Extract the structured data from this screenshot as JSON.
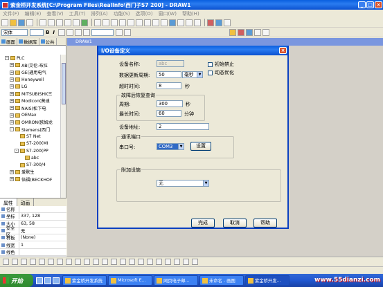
{
  "window": {
    "title": "紫金桥开发系统[C:\\Program Files\\RealInfo\\西门子S7 200] - DRAW1"
  },
  "menu": [
    "文件(F)",
    "编辑(E)",
    "查看(V)",
    "工具(T)",
    "排列(A)",
    "功能(S)",
    "选项(O)",
    "窗口(W)",
    "帮助(H)"
  ],
  "toolbar": {
    "font": "宋体",
    "bold": "B",
    "italic": "I"
  },
  "left_panel": {
    "tabs": [
      "画面",
      "数据库",
      "公共"
    ],
    "tree": [
      {
        "indent": 1,
        "sign": "-",
        "label": "PLC"
      },
      {
        "indent": 2,
        "sign": "+",
        "label": "AB(艾伦-布拉"
      },
      {
        "indent": 2,
        "sign": "+",
        "label": "GE(通用电气"
      },
      {
        "indent": 2,
        "sign": "+",
        "label": "Honeywell"
      },
      {
        "indent": 2,
        "sign": "+",
        "label": "LG"
      },
      {
        "indent": 2,
        "sign": "+",
        "label": "MITSUBISHI(三"
      },
      {
        "indent": 2,
        "sign": "+",
        "label": "Modicon(莫迪"
      },
      {
        "indent": 2,
        "sign": "+",
        "label": "NAIS(松下电"
      },
      {
        "indent": 2,
        "sign": "+",
        "label": "OEMax"
      },
      {
        "indent": 2,
        "sign": "+",
        "label": "OMRON(欧姆龙"
      },
      {
        "indent": 2,
        "sign": "-",
        "label": "Siemens(西门"
      },
      {
        "indent": 3,
        "sign": "",
        "label": "S7 Net"
      },
      {
        "indent": 3,
        "sign": "",
        "label": "S7-200(MI"
      },
      {
        "indent": 3,
        "sign": "-",
        "label": "S7-200(PP"
      },
      {
        "indent": 4,
        "sign": "",
        "label": "abc"
      },
      {
        "indent": 3,
        "sign": "",
        "label": "S7-300/4"
      },
      {
        "indent": 2,
        "sign": "+",
        "label": "爱默生"
      },
      {
        "indent": 2,
        "sign": "+",
        "label": "倍福(BECKHOF"
      }
    ]
  },
  "properties": {
    "tabs": [
      "属性",
      "动画"
    ],
    "rows": [
      {
        "name": "名称",
        "value": ""
      },
      {
        "name": "坐标",
        "value": "337, 128"
      },
      {
        "name": "大小",
        "value": "63, 58"
      },
      {
        "name": "安全区",
        "value": "无"
      },
      {
        "name": "样板",
        "value": "(None)"
      },
      {
        "name": "线宽",
        "value": "1"
      },
      {
        "name": "线色",
        "value": ""
      }
    ]
  },
  "child_window": {
    "title": "DRAW1"
  },
  "dialog": {
    "title": "I/O设备定义",
    "device_name_label": "设备名称:",
    "device_name_value": "abc",
    "update_period_label": "数据更新周期:",
    "update_period_value": "50",
    "update_unit": "毫秒",
    "timeout_label": "超时时间:",
    "timeout_value": "8",
    "timeout_unit": "秒",
    "init_disable": "初始禁止",
    "dynamic_opt": "动态优化",
    "recovery_group": "故障后恢复查询",
    "period_label": "周期:",
    "period_value": "300",
    "period_unit": "秒",
    "max_time_label": "最长时间:",
    "max_time_value": "60",
    "max_time_unit": "分钟",
    "address_label": "设备地址:",
    "address_value": "2",
    "port_group": "通讯端口",
    "serial_label": "串口号:",
    "serial_value": "COM3",
    "settings_button": "设置",
    "extra_group": "附加设施",
    "extra_value": "无",
    "ok_button": "完成",
    "cancel_button": "取消",
    "help_button": "帮助"
  },
  "taskbar": {
    "start": "开始",
    "tasks": [
      "紫金桥开发系统",
      "Microsoft E...",
      "网页电子邮...",
      "未命名 - 画图",
      "紫金桥开发..."
    ]
  },
  "watermark": "www.55dianzi.com"
}
